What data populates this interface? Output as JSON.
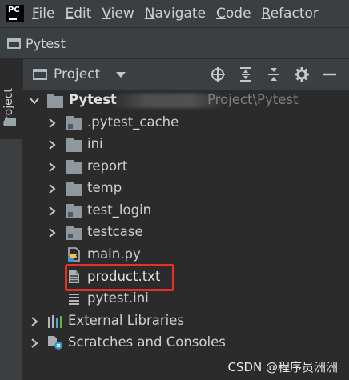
{
  "app": {
    "logo_text": "PC",
    "menu": [
      {
        "mnemonic": "F",
        "rest": "ile"
      },
      {
        "mnemonic": "E",
        "rest": "dit"
      },
      {
        "mnemonic": "V",
        "rest": "iew"
      },
      {
        "mnemonic": "N",
        "rest": "avigate"
      },
      {
        "mnemonic": "C",
        "rest": "ode"
      },
      {
        "mnemonic": "R",
        "rest": "efactor"
      }
    ]
  },
  "navbar": {
    "project_name": "Pytest"
  },
  "side": {
    "tab_label": "Project"
  },
  "panel": {
    "title": "Project",
    "tools": [
      "crosshair-icon",
      "expand-all-icon",
      "collapse-all-icon",
      "gear-icon",
      "minimize-icon"
    ]
  },
  "tree": {
    "root": {
      "name": "Pytest",
      "path": "Project\\Pytest"
    },
    "folders": [
      {
        "name": ".pytest_cache",
        "marked": true
      },
      {
        "name": "ini",
        "marked": false
      },
      {
        "name": "report",
        "marked": false
      },
      {
        "name": "temp",
        "marked": false
      },
      {
        "name": "test_login",
        "marked": true
      },
      {
        "name": "testcase",
        "marked": true
      }
    ],
    "files": [
      {
        "name": "main.py",
        "type": "python"
      },
      {
        "name": "product.txt",
        "type": "text"
      },
      {
        "name": "pytest.ini",
        "type": "ini"
      }
    ],
    "extra": [
      {
        "name": "External Libraries",
        "icon": "library-icon"
      },
      {
        "name": "Scratches and Consoles",
        "icon": "scratches-icon"
      }
    ]
  },
  "watermark": "CSDN @程序员洲洲",
  "colors": {
    "highlight": "#e7302a",
    "tree_bg": "#2b2b2b",
    "chrome_bg": "#3c3f41"
  }
}
